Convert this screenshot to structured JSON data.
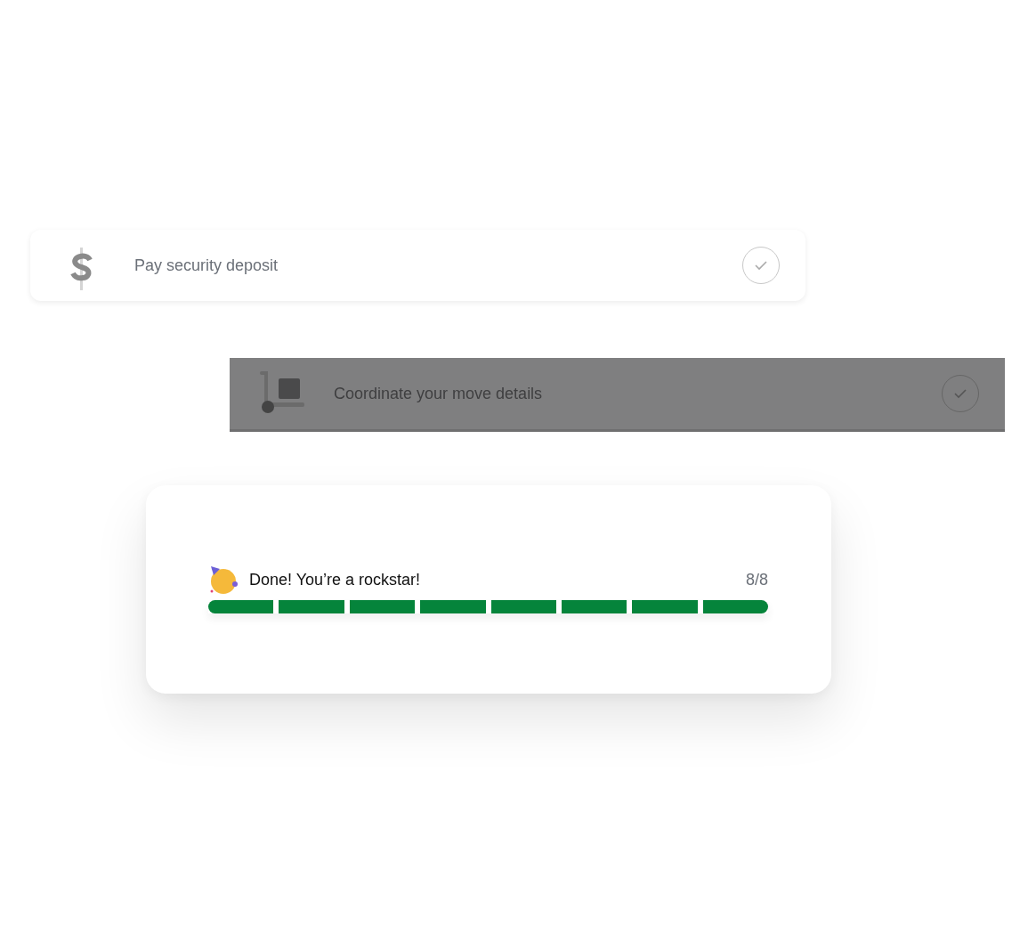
{
  "tasks": [
    {
      "kind": "dollar",
      "label": "Pay security deposit",
      "dimmed": false
    },
    {
      "kind": "dolly",
      "label": "Coordinate your move details",
      "dimmed": true
    }
  ],
  "progress": {
    "message": "Done! You’re a rockstar!",
    "count": "8/8",
    "segments": [
      {
        "done": true
      },
      {
        "done": true
      },
      {
        "done": true
      },
      {
        "done": true
      },
      {
        "done": true
      },
      {
        "done": true
      },
      {
        "done": true
      },
      {
        "done": true
      }
    ]
  }
}
